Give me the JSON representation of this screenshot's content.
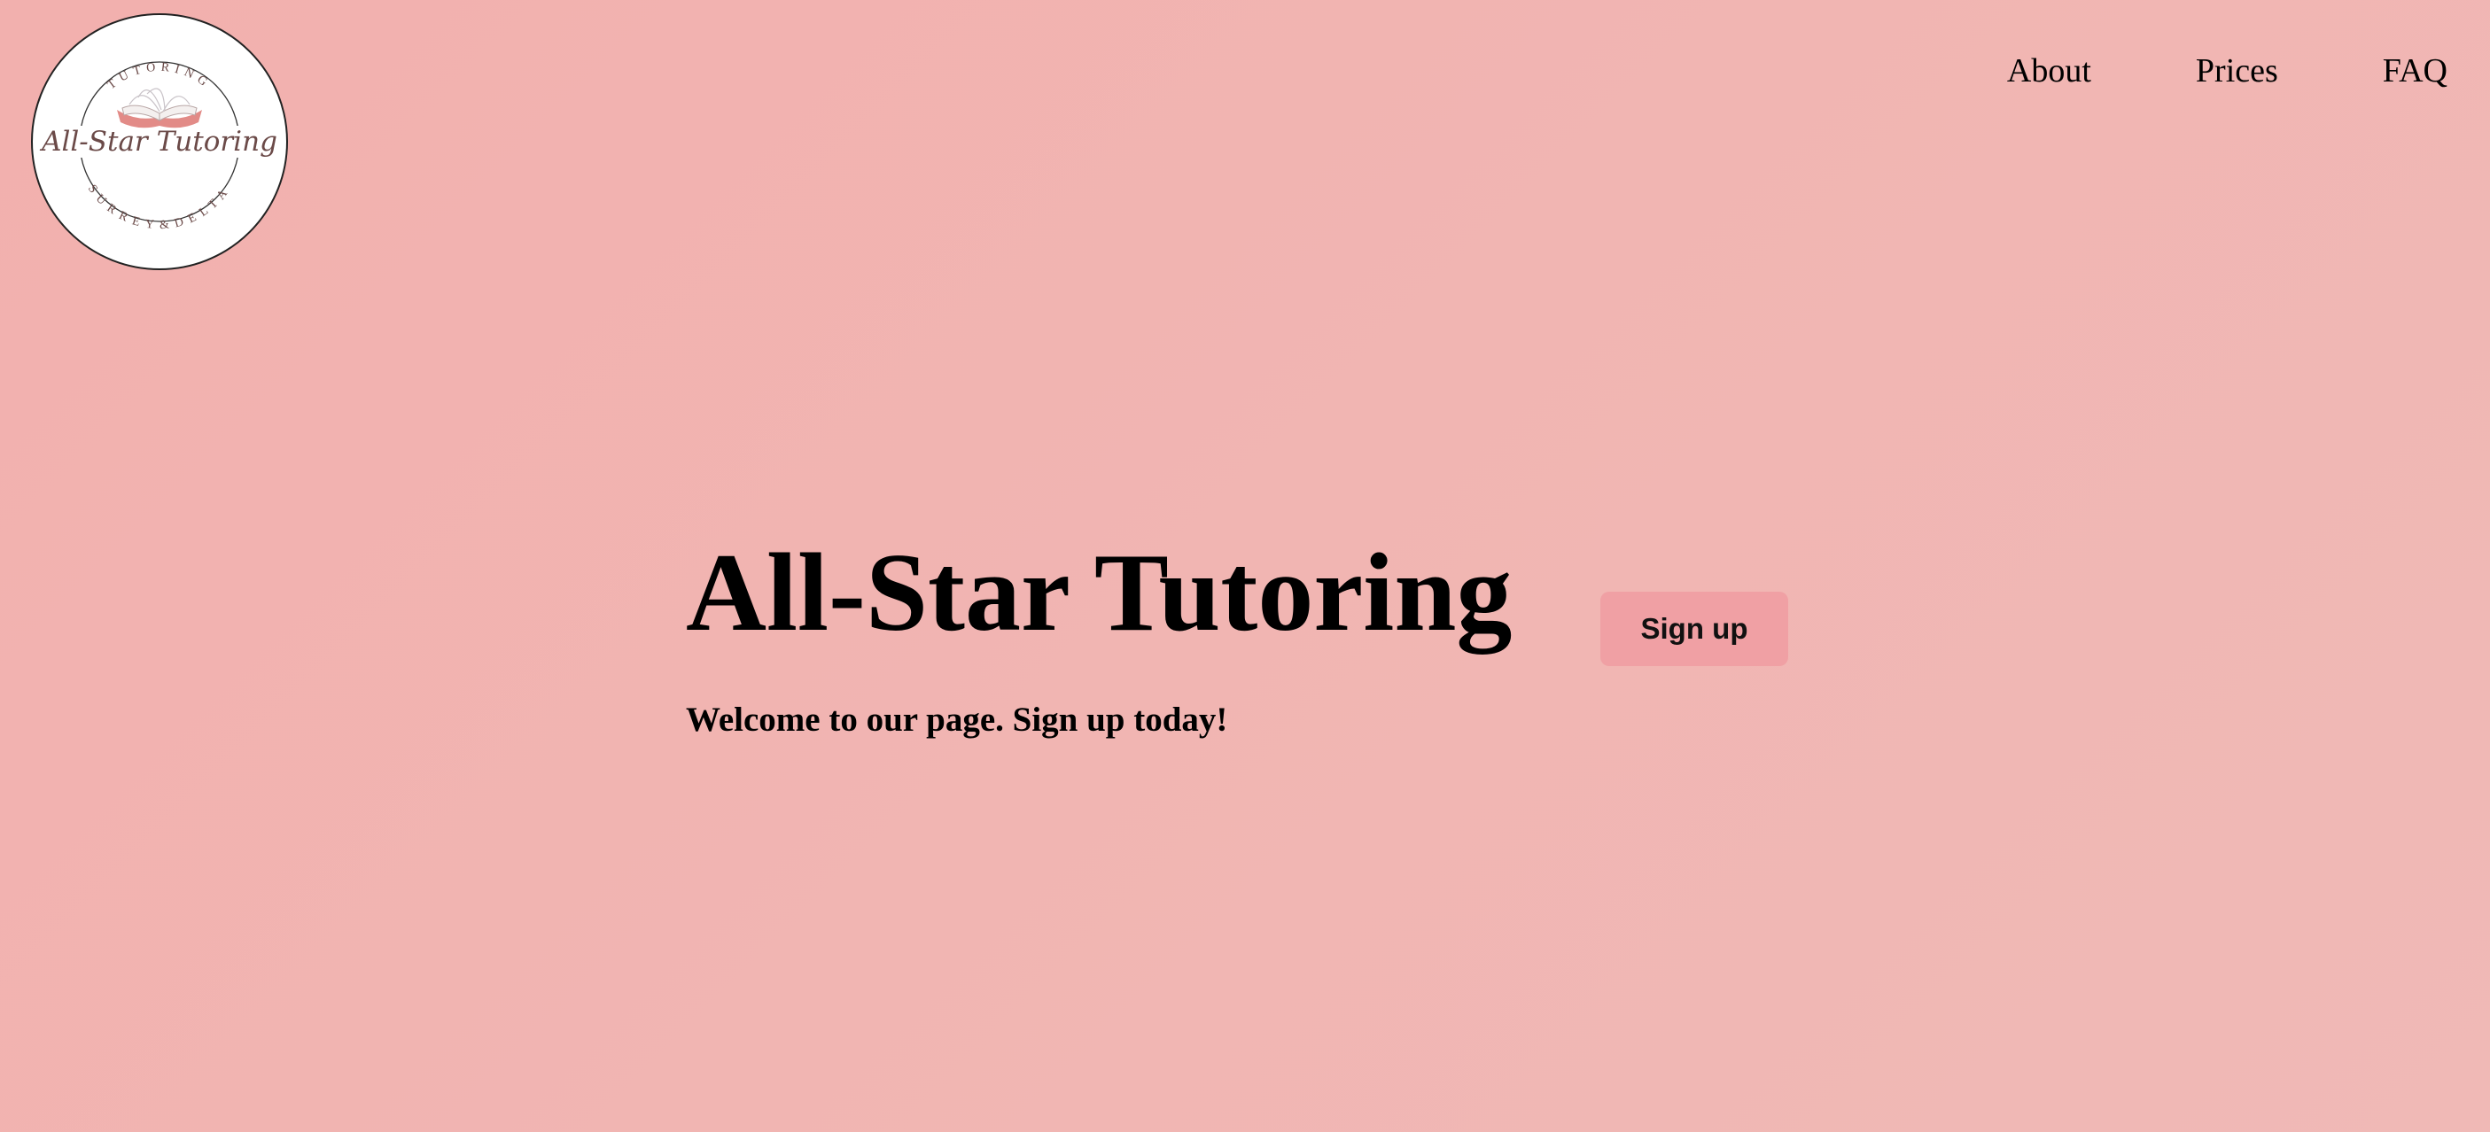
{
  "logo": {
    "top_text": "TUTORING",
    "name": "All-Star Tutoring",
    "bottom_text": "SURREY&DELTA"
  },
  "nav": {
    "items": [
      {
        "label": "About"
      },
      {
        "label": "Prices"
      },
      {
        "label": "FAQ"
      }
    ]
  },
  "hero": {
    "title": "All-Star Tutoring",
    "subtitle": "Welcome to our page. Sign up today!",
    "signup_label": "Sign up"
  },
  "colors": {
    "background": "#f2b3b1",
    "button": "#f0a0a4",
    "logo_accent": "#e28b87",
    "logo_text": "#6b4a48"
  },
  "icons": {
    "logo_book": "open-book-icon"
  }
}
